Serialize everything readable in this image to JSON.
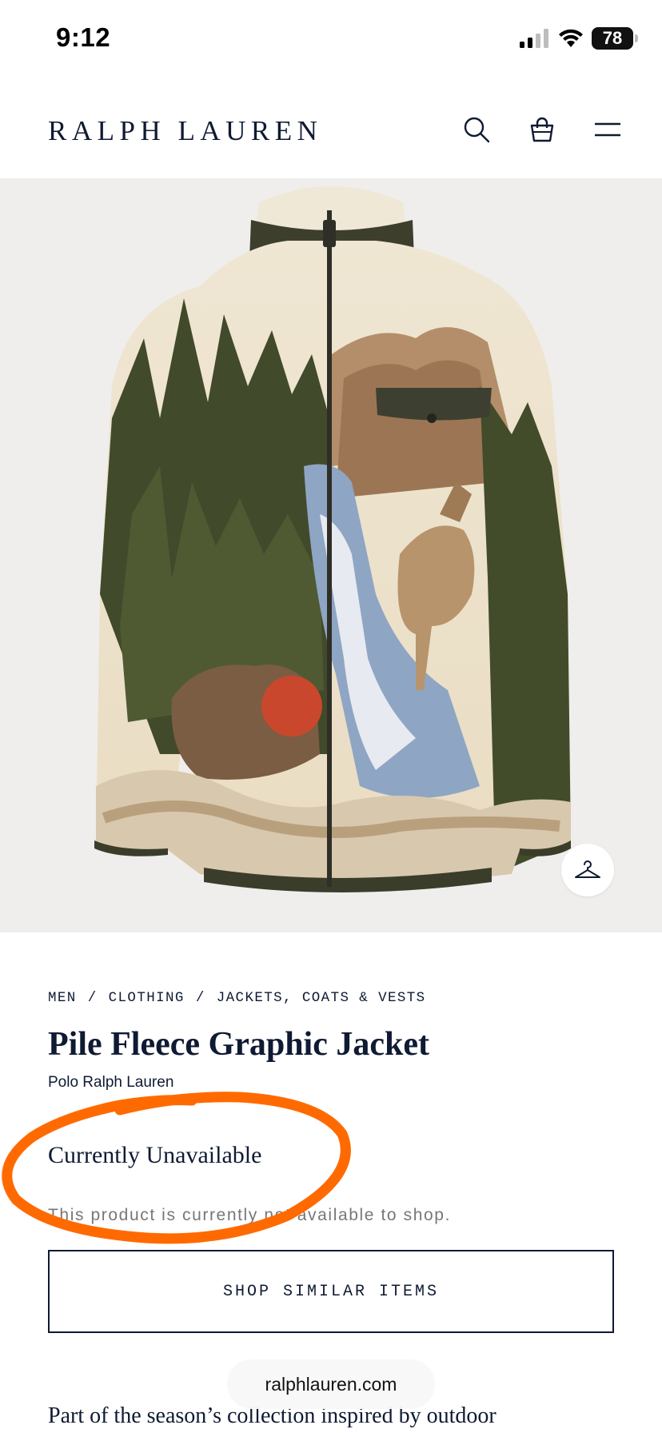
{
  "status_bar": {
    "time": "9:12",
    "battery": "78",
    "icons": [
      "cellular-signal-icon",
      "wifi-icon",
      "battery-icon"
    ]
  },
  "header": {
    "brand": "RALPH LAUREN",
    "icons": [
      "search-icon",
      "shopping-bag-icon",
      "menu-icon"
    ]
  },
  "product": {
    "breadcrumb": [
      "MEN",
      "CLOTHING",
      "JACKETS, COATS & VESTS"
    ],
    "breadcrumb_separator": "/",
    "title": "Pile Fleece Graphic Jacket",
    "brand": "Polo Ralph Lauren",
    "availability_heading": "Currently Unavailable",
    "availability_message": "This product is currently not available to shop.",
    "shop_similar_label": "SHOP SIMILAR ITEMS",
    "description_preview": "Part of the season’s collection inspired by outdoor"
  },
  "browser": {
    "url": "ralphlauren.com"
  },
  "colors": {
    "navy": "#0f1a33",
    "image_background": "#efeeec",
    "annotation_orange": "#ff6a00"
  }
}
